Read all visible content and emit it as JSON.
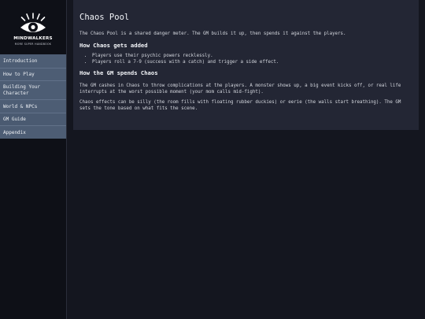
{
  "logo": {
    "title": "MINDWALKERS",
    "subtitle": "MORE SUPER HANDBOOK"
  },
  "nav": {
    "items": [
      {
        "label": "Introduction"
      },
      {
        "label": "How to Play"
      },
      {
        "label": "Building Your Character"
      },
      {
        "label": "World & NPCs"
      },
      {
        "label": "GM Guide"
      },
      {
        "label": "Appendix"
      }
    ]
  },
  "article": {
    "title": "Chaos Pool",
    "intro": "The Chaos Pool is a shared danger meter. The GM builds it up, then spends it against the players.",
    "section1": {
      "heading": "How Chaos gets added",
      "bullets": [
        "Players use their psychic powers recklessly.",
        "Players roll a 7-9 (success with a catch) and trigger a side effect."
      ]
    },
    "section2": {
      "heading": "How the GM spends Chaos",
      "para1": "The GM cashes in Chaos to throw complications at the players. A monster shows up, a big event kicks off, or real life interrupts at the worst possible moment (your mom calls mid-fight).",
      "para2": "Chaos effects can be silly (the room fills with floating rubber duckies) or eerie (the walls start breathing). The GM sets the tone based on what fits the scene."
    }
  }
}
